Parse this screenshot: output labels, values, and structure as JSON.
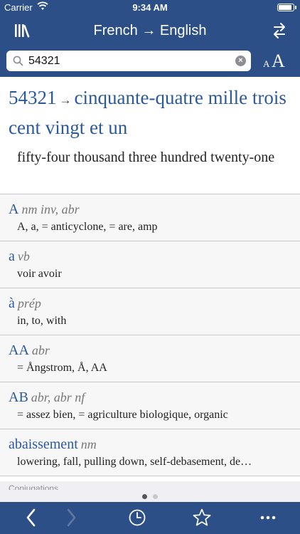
{
  "status_bar": {
    "carrier": "Carrier",
    "time": "9:34 AM",
    "battery_level": 0.9
  },
  "nav": {
    "title": "French → English",
    "left_icon": "library-icon",
    "right_icon": "swap-direction-icon"
  },
  "search": {
    "value": "54321",
    "placeholder": ""
  },
  "font_size": {
    "small": "A",
    "large": "A"
  },
  "main_entry": {
    "headword_1": "54321",
    "arrow": "→",
    "headword_2": "cinquante-quatre mille trois cent vingt et un",
    "translation": "fifty-four thousand three hundred twenty-one"
  },
  "entries": [
    {
      "term": "A",
      "pos": "nm inv, abr",
      "definition": "A, a, = anticyclone, = are, amp"
    },
    {
      "term": "a",
      "pos": "vb",
      "definition": "voir avoir"
    },
    {
      "term": "à",
      "pos": "prép",
      "definition": "in, to, with"
    },
    {
      "term": "AA",
      "pos": "abr",
      "definition": "= Ångstrom, Å, AA"
    },
    {
      "term": "AB",
      "pos": "abr, abr nf",
      "definition": "= assez bien, = agriculture biologique, organic"
    },
    {
      "term": "abaissement",
      "pos": "nm",
      "definition": "lowering, fall, pulling down, self-debasement, de…"
    }
  ],
  "section_label": "Conjugations",
  "pager": {
    "pages": 2,
    "current": 1
  },
  "toolbar": {
    "back": "chevron-left-icon",
    "forward": "chevron-right-icon",
    "history": "clock-icon",
    "favorites": "star-icon",
    "more": "more-icon"
  },
  "colors": {
    "bar": "#2b4f86",
    "link": "#2b5a9b"
  }
}
